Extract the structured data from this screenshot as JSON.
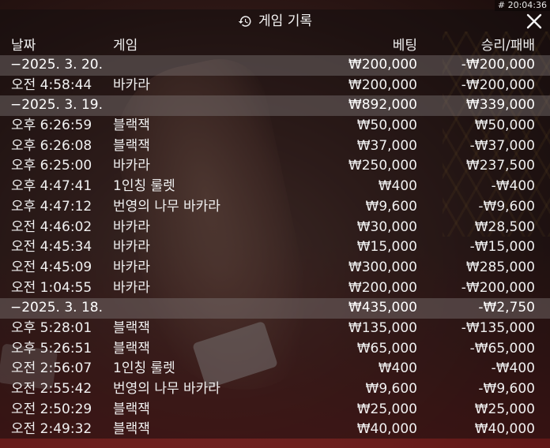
{
  "clock": "# 20:04:36",
  "title": "게임 기록",
  "icons": {
    "history": "history-icon",
    "close": "close-icon"
  },
  "columns": {
    "date": "날짜",
    "game": "게임",
    "bet": "베팅",
    "result": "승리/패배"
  },
  "rows": [
    {
      "type": "group",
      "date": "−2025. 3. 20.",
      "game": "",
      "bet": "₩200,000",
      "result": "-₩200,000"
    },
    {
      "type": "item",
      "date": "오전 4:58:44",
      "game": "바카라",
      "bet": "₩200,000",
      "result": "-₩200,000"
    },
    {
      "type": "group",
      "date": "−2025. 3. 19.",
      "game": "",
      "bet": "₩892,000",
      "result": "₩339,000"
    },
    {
      "type": "item",
      "date": "오후 6:26:59",
      "game": "블랙잭",
      "bet": "₩50,000",
      "result": "₩50,000"
    },
    {
      "type": "item",
      "date": "오후 6:26:08",
      "game": "블랙잭",
      "bet": "₩37,000",
      "result": "-₩37,000"
    },
    {
      "type": "item",
      "date": "오후 6:25:00",
      "game": "바카라",
      "bet": "₩250,000",
      "result": "₩237,500"
    },
    {
      "type": "item",
      "date": "오후 4:47:41",
      "game": "1인칭 룰렛",
      "bet": "₩400",
      "result": "-₩400"
    },
    {
      "type": "item",
      "date": "오후 4:47:12",
      "game": "번영의 나무 바카라",
      "bet": "₩9,600",
      "result": "-₩9,600"
    },
    {
      "type": "item",
      "date": "오전 4:46:02",
      "game": "바카라",
      "bet": "₩30,000",
      "result": "₩28,500"
    },
    {
      "type": "item",
      "date": "오전 4:45:34",
      "game": "바카라",
      "bet": "₩15,000",
      "result": "-₩15,000"
    },
    {
      "type": "item",
      "date": "오전 4:45:09",
      "game": "바카라",
      "bet": "₩300,000",
      "result": "₩285,000"
    },
    {
      "type": "item",
      "date": "오전 1:04:55",
      "game": "바카라",
      "bet": "₩200,000",
      "result": "-₩200,000"
    },
    {
      "type": "group",
      "date": "−2025. 3. 18.",
      "game": "",
      "bet": "₩435,000",
      "result": "-₩2,750"
    },
    {
      "type": "item",
      "date": "오후 5:28:01",
      "game": "블랙잭",
      "bet": "₩135,000",
      "result": "-₩135,000"
    },
    {
      "type": "item",
      "date": "오후 5:26:51",
      "game": "블랙잭",
      "bet": "₩65,000",
      "result": "-₩65,000"
    },
    {
      "type": "item",
      "date": "오전 2:56:07",
      "game": "1인칭 룰렛",
      "bet": "₩400",
      "result": "-₩400"
    },
    {
      "type": "item",
      "date": "오전 2:55:42",
      "game": "번영의 나무 바카라",
      "bet": "₩9,600",
      "result": "-₩9,600"
    },
    {
      "type": "item",
      "date": "오전 2:50:29",
      "game": "블랙잭",
      "bet": "₩25,000",
      "result": "₩25,000"
    },
    {
      "type": "item",
      "date": "오전 2:49:32",
      "game": "블랙잭",
      "bet": "₩40,000",
      "result": "₩40,000"
    }
  ]
}
